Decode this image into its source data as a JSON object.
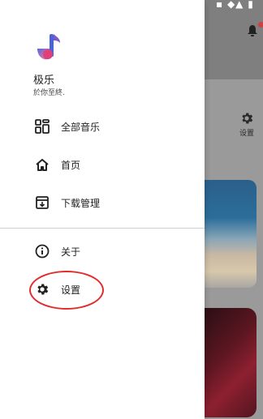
{
  "drawer": {
    "app_name": "极乐",
    "app_tagline": "於你至終.",
    "items": [
      {
        "label": "全部音乐",
        "icon": "grid-icon"
      },
      {
        "label": "首页",
        "icon": "home-icon"
      },
      {
        "label": "下载管理",
        "icon": "download-icon"
      },
      {
        "label": "关于",
        "icon": "info-icon"
      },
      {
        "label": "设置",
        "icon": "gear-icon"
      }
    ]
  },
  "background": {
    "settings_label": "设置"
  },
  "colors": {
    "drawer_bg": "#ffffff",
    "accent_pink": "#e0407a",
    "accent_blue": "#4a63d8",
    "highlight_red": "#e12d2d"
  }
}
